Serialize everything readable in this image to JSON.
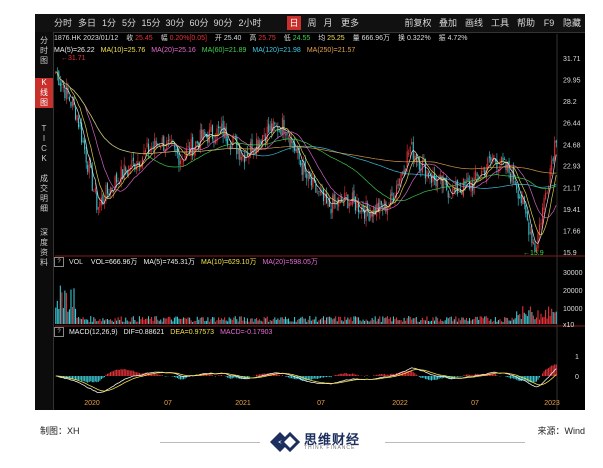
{
  "toolbar": {
    "items": [
      "分时",
      "多日",
      "1分",
      "5分",
      "15分",
      "30分",
      "60分",
      "90分",
      "2小时",
      "日",
      "周",
      "月",
      "更多",
      "前复权",
      "叠加",
      "画线",
      "工具",
      "帮助",
      "F9",
      "隐藏"
    ],
    "active": "日"
  },
  "sidebar": {
    "items": [
      "分\n时\n图",
      "K\n线\n图",
      "T\nI\nC\nK",
      "成\n交\n明\n细",
      "深\n度\n资\n料"
    ],
    "active": "K\n线\n图"
  },
  "info": {
    "code_date": "1876.HK 2023/01/12",
    "close_label": "收",
    "close": "25.45",
    "chg_label": "幅",
    "chg": "0.20%[0.05]",
    "open_label": "开",
    "open": "25.40",
    "high_label": "高",
    "high": "25.75",
    "low_label": "低",
    "low": "24.55",
    "avg_label": "均",
    "avg": "25.25",
    "vol_label": "量",
    "vol": "666.96万",
    "turn_label": "换",
    "turn": "0.322%",
    "amp_label": "振",
    "amp": "4.72%"
  },
  "ma": [
    {
      "text": "MA(5)=26.22",
      "color": "#f0f0f0"
    },
    {
      "text": "MA(10)=25.76",
      "color": "#f2e14b"
    },
    {
      "text": "MA(20)=25.16",
      "color": "#e86bd3"
    },
    {
      "text": "MA(60)=21.89",
      "color": "#3fd64f"
    },
    {
      "text": "MA(120)=21.98",
      "color": "#3fc9e8"
    },
    {
      "text": "MA(250)=21.57",
      "color": "#e8a24b"
    }
  ],
  "vol": {
    "q": "?",
    "name": "VOL",
    "items": [
      {
        "text": "VOL=666.96万",
        "color": "#f0f0f0"
      },
      {
        "text": "MA(5)=745.31万",
        "color": "#f0f0f0"
      },
      {
        "text": "MA(10)=629.10万",
        "color": "#f2e14b"
      },
      {
        "text": "MA(20)=598.05万",
        "color": "#e86bd3"
      }
    ],
    "axis": [
      "30000",
      "20000",
      "10000",
      "x10"
    ]
  },
  "macd": {
    "q": "?",
    "items": [
      {
        "text": "MACD(12,26,9)",
        "color": "#f0f0f0"
      },
      {
        "text": "DIF=0.88621",
        "color": "#f0f0f0"
      },
      {
        "text": "DEA=0.97573",
        "color": "#f2e14b"
      },
      {
        "text": "MACD=-0.17903",
        "color": "#e86bd3"
      }
    ],
    "axis": [
      "1",
      "0"
    ]
  },
  "chart_data": {
    "type": "line",
    "title": "",
    "y_ticks": [
      31.71,
      29.95,
      28.2,
      26.44,
      24.68,
      22.93,
      21.17,
      19.41,
      17.66,
      15.9
    ],
    "ylim": [
      15.9,
      31.71
    ],
    "annotations": [
      {
        "text": "31.71",
        "at": "high"
      },
      {
        "text": "15.9",
        "at": "low"
      }
    ],
    "x_labels": [
      "2020",
      "07",
      "2021",
      "07",
      "2022",
      "07",
      "2023"
    ],
    "close_keypoints": [
      [
        "2020-01",
        30.6
      ],
      [
        "2020-02",
        27.2
      ],
      [
        "2020-03",
        19.6
      ],
      [
        "2020-04",
        22.0
      ],
      [
        "2020-06",
        23.5
      ],
      [
        "2020-08",
        25.0
      ],
      [
        "2020-10",
        23.6
      ],
      [
        "2020-12",
        25.2
      ],
      [
        "2021-02",
        25.8
      ],
      [
        "2021-04",
        23.8
      ],
      [
        "2021-06",
        25.6
      ],
      [
        "2021-07",
        26.3
      ],
      [
        "2021-09",
        22.0
      ],
      [
        "2021-11",
        19.6
      ],
      [
        "2022-01",
        20.2
      ],
      [
        "2022-03",
        19.2
      ],
      [
        "2022-05",
        19.8
      ],
      [
        "2022-06",
        24.4
      ],
      [
        "2022-07",
        22.0
      ],
      [
        "2022-08",
        20.8
      ],
      [
        "2022-10",
        21.5
      ],
      [
        "2022-11",
        23.6
      ],
      [
        "2022-12",
        22.0
      ],
      [
        "2022-12b",
        16.2
      ],
      [
        "2023-01",
        25.45
      ]
    ]
  },
  "footer": {
    "left": "制图：XH",
    "right": "来源：Wind",
    "logo_text": "思维财经",
    "logo_sub": "THINK FINANCE"
  },
  "colors": {
    "up": "#e8333a",
    "down": "#3ccbd6",
    "bg": "#000000"
  }
}
